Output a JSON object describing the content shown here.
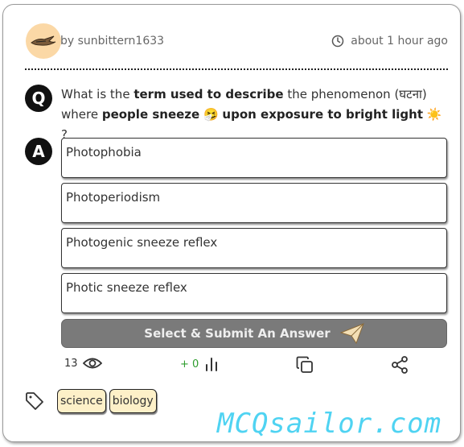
{
  "header": {
    "author": "by sunbittern1633",
    "timestamp": "about 1 hour ago"
  },
  "question": {
    "badge": "Q",
    "parts": {
      "p1": "What is the ",
      "p2": "term used to describe",
      "p3": " the phenomenon (घटना) where ",
      "p4": "people sneeze",
      "p5": " 🤧 ",
      "p6": "upon exposure to bright light",
      "p7": " ☀️ ?"
    }
  },
  "answer": {
    "badge": "A",
    "options": [
      "Photophobia",
      "Photoperiodism",
      "Photogenic sneeze reflex",
      "Photic sneeze reflex"
    ]
  },
  "submit": {
    "label": "Select & Submit An Answer"
  },
  "stats": {
    "views": "13",
    "votes": "+ 0"
  },
  "tags": [
    "science",
    "biology"
  ],
  "watermark": "MCQsailor.com"
}
